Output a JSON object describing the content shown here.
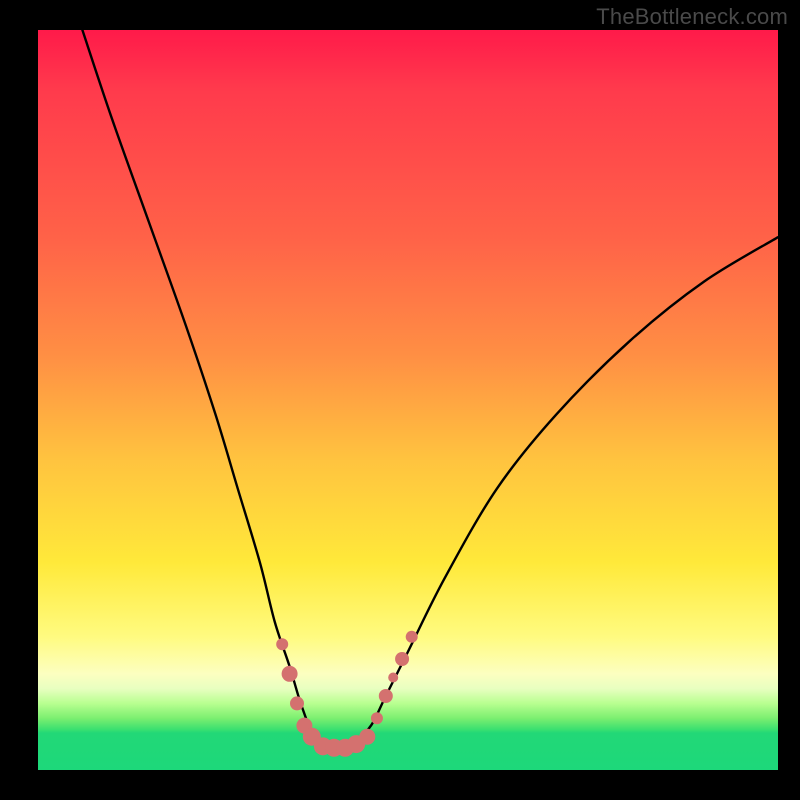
{
  "watermark": "TheBottleneck.com",
  "chart_data": {
    "type": "line",
    "title": "",
    "xlabel": "",
    "ylabel": "",
    "xlim": [
      0,
      100
    ],
    "ylim": [
      0,
      100
    ],
    "series": [
      {
        "name": "bottleneck-curve",
        "x": [
          6,
          10,
          15,
          20,
          24,
          27,
          30,
          32,
          34,
          35.5,
          37,
          38,
          39.5,
          41,
          43,
          45,
          47,
          50,
          55,
          62,
          70,
          80,
          90,
          100
        ],
        "values": [
          100,
          88,
          74,
          60,
          48,
          38,
          28,
          20,
          14,
          9,
          5,
          3,
          3,
          3,
          4,
          6,
          10,
          16,
          26,
          38,
          48,
          58,
          66,
          72
        ]
      }
    ],
    "markers": {
      "name": "highlight-dots",
      "color": "#d4716f",
      "points": [
        {
          "x": 33.0,
          "y": 17,
          "r": 6
        },
        {
          "x": 34.0,
          "y": 13,
          "r": 8
        },
        {
          "x": 35.0,
          "y": 9,
          "r": 7
        },
        {
          "x": 36.0,
          "y": 6,
          "r": 8
        },
        {
          "x": 37.0,
          "y": 4.5,
          "r": 9
        },
        {
          "x": 38.5,
          "y": 3.2,
          "r": 9
        },
        {
          "x": 40.0,
          "y": 3.0,
          "r": 9
        },
        {
          "x": 41.5,
          "y": 3.0,
          "r": 9
        },
        {
          "x": 43.0,
          "y": 3.5,
          "r": 9
        },
        {
          "x": 44.5,
          "y": 4.5,
          "r": 8
        },
        {
          "x": 45.8,
          "y": 7,
          "r": 6
        },
        {
          "x": 47.0,
          "y": 10,
          "r": 7
        },
        {
          "x": 48.0,
          "y": 12.5,
          "r": 5
        },
        {
          "x": 49.2,
          "y": 15,
          "r": 7
        },
        {
          "x": 50.5,
          "y": 18,
          "r": 6
        }
      ]
    },
    "gradient_bands": [
      {
        "name": "red",
        "from": 100,
        "to": 82
      },
      {
        "name": "orange",
        "from": 82,
        "to": 50
      },
      {
        "name": "yellow",
        "from": 50,
        "to": 18
      },
      {
        "name": "pale",
        "from": 18,
        "to": 9
      },
      {
        "name": "green",
        "from": 9,
        "to": 0
      }
    ]
  }
}
